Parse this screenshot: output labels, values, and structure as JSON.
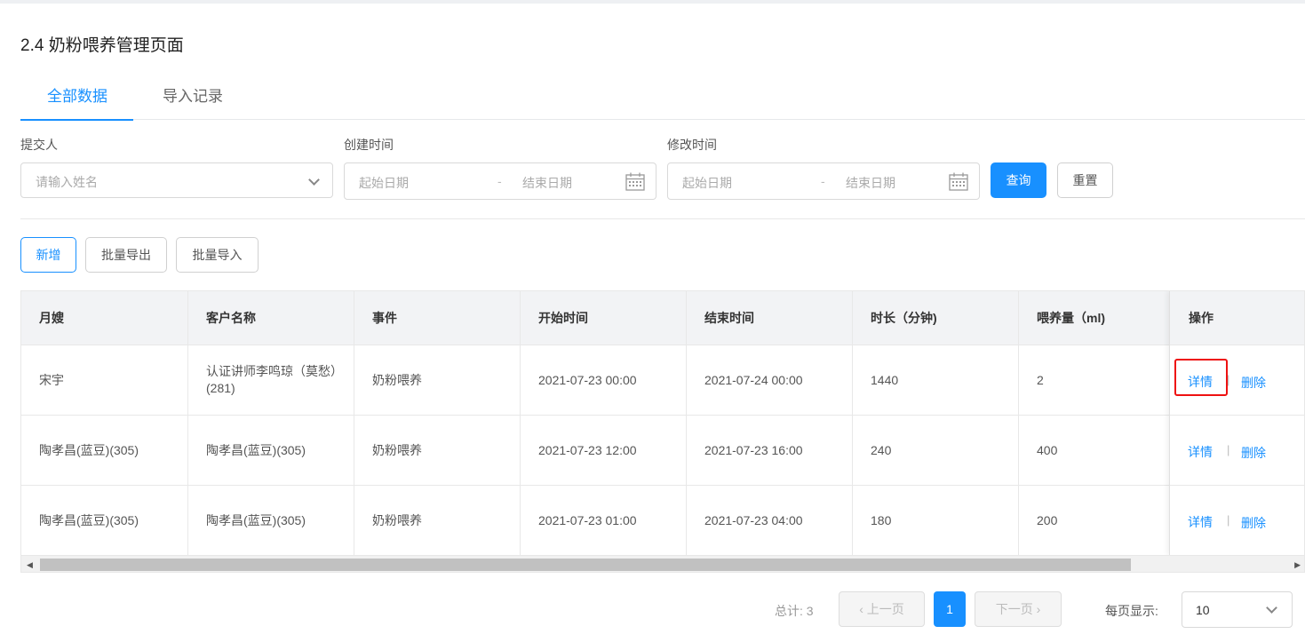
{
  "page": {
    "title": "2.4 奶粉喂养管理页面"
  },
  "tabs": [
    {
      "label": "全部数据",
      "active": true
    },
    {
      "label": "导入记录",
      "active": false
    }
  ],
  "filters": {
    "submitter": {
      "label": "提交人",
      "placeholder": "请输入姓名"
    },
    "created_time": {
      "label": "创建时间",
      "start_placeholder": "起始日期",
      "separator": "-",
      "end_placeholder": "结束日期"
    },
    "modified_time": {
      "label": "修改时间",
      "start_placeholder": "起始日期",
      "separator": "-",
      "end_placeholder": "结束日期"
    },
    "query_label": "查询",
    "reset_label": "重置"
  },
  "actions": {
    "add_label": "新增",
    "export_label": "批量导出",
    "import_label": "批量导入"
  },
  "table": {
    "headers": [
      "月嫂",
      "客户名称",
      "事件",
      "开始时间",
      "结束时间",
      "时长（分钟)",
      "喂养量（ml)",
      "操作"
    ],
    "rows": [
      {
        "nanny": "宋宇",
        "customer": "认证讲师李鸣琼（莫愁）(281)",
        "event": "奶粉喂养",
        "start": "2021-07-23 00:00",
        "end": "2021-07-24 00:00",
        "duration": "1440",
        "amount": "2",
        "detail": "详情",
        "delete": "删除"
      },
      {
        "nanny": "陶孝昌(蓝豆)(305)",
        "customer": "陶孝昌(蓝豆)(305)",
        "event": "奶粉喂养",
        "start": "2021-07-23 12:00",
        "end": "2021-07-23 16:00",
        "duration": "240",
        "amount": "400",
        "detail": "详情",
        "delete": "删除"
      },
      {
        "nanny": "陶孝昌(蓝豆)(305)",
        "customer": "陶孝昌(蓝豆)(305)",
        "event": "奶粉喂养",
        "start": "2021-07-23 01:00",
        "end": "2021-07-23 04:00",
        "duration": "180",
        "amount": "200",
        "detail": "详情",
        "delete": "删除"
      }
    ],
    "op_separator": "|"
  },
  "pagination": {
    "total_label": "总计: 3",
    "prev_label": "上一页",
    "current_page": "1",
    "next_label": "下一页",
    "page_size_label": "每页显示:",
    "page_size": "10"
  },
  "colors": {
    "accent": "#1890ff",
    "highlight": "#ee1111"
  }
}
